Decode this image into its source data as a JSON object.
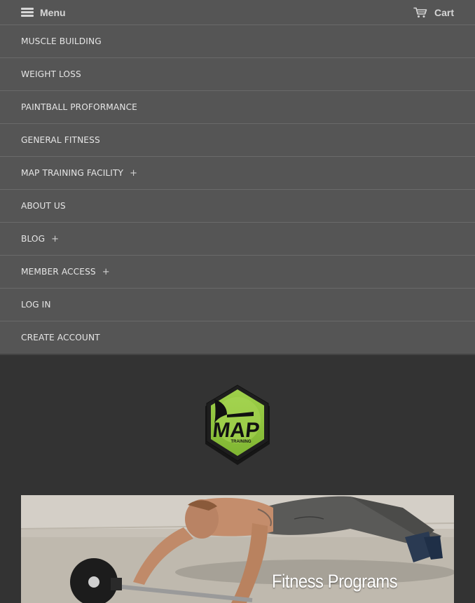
{
  "header": {
    "menu_label": "Menu",
    "cart_label": "Cart"
  },
  "nav": {
    "items": [
      {
        "label": "MUSCLE BUILDING",
        "expandable": false
      },
      {
        "label": "WEIGHT LOSS",
        "expandable": false
      },
      {
        "label": "PAINTBALL PROFORMANCE",
        "expandable": false
      },
      {
        "label": "GENERAL FITNESS",
        "expandable": false
      },
      {
        "label": "MAP TRAINING FACILITY",
        "expandable": true
      },
      {
        "label": "ABOUT US",
        "expandable": false
      },
      {
        "label": "BLOG",
        "expandable": true
      },
      {
        "label": "MEMBER ACCESS",
        "expandable": true
      },
      {
        "label": "LOG IN",
        "expandable": false
      },
      {
        "label": "CREATE ACCOUNT",
        "expandable": false
      }
    ],
    "expand_glyph": "+"
  },
  "logo": {
    "text": "MAP",
    "subtext": "TRAINING",
    "colors": {
      "hex": "#8dc63f",
      "rim": "#1a1a1a"
    }
  },
  "hero": {
    "title": "Fitness Programs"
  },
  "icons": {
    "menu": "hamburger-icon",
    "cart": "cart-icon",
    "expand": "plus-icon"
  },
  "colors": {
    "topbar": "#555555",
    "page": "#333333",
    "nav_text": "#e6e6e6",
    "divider": "#6a6a6a"
  }
}
